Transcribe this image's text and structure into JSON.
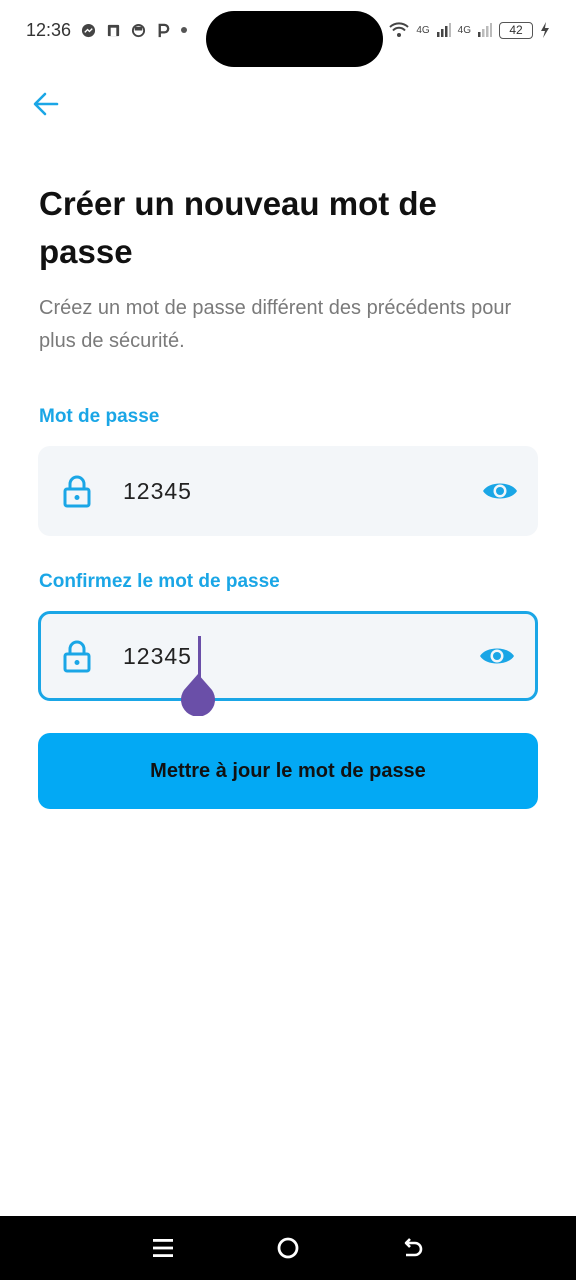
{
  "status_bar": {
    "time": "12:36",
    "network_1": "4G",
    "network_2": "4G",
    "battery": "42"
  },
  "header": {
    "title": "Créer un nouveau mot de passe",
    "subtitle": "Créez un mot de passe différent des précédents pour plus de sécurité."
  },
  "form": {
    "password_label": "Mot de passe",
    "password_value": "12345",
    "confirm_label": "Confirmez le mot de passe",
    "confirm_value": "12345",
    "submit_label": "Mettre à jour le mot de passe"
  },
  "colors": {
    "accent": "#1aa6e6",
    "button": "#03a9f4",
    "field_bg": "#f3f6f9",
    "caret": "#6a4fa8"
  },
  "icons": {
    "back": "arrow-left-icon",
    "lock": "lock-icon",
    "visibility": "eye-icon"
  }
}
